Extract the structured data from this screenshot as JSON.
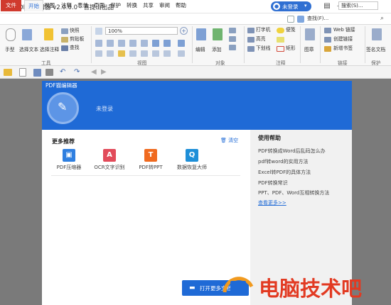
{
  "titlebar": {
    "title": "PDF猫编辑器 v2.0.0.0 - 喜提山出品",
    "user_label": "未登录",
    "user_arrow": "▾",
    "minimize": "—",
    "restore": "❐",
    "close": "✕",
    "extra": "▤"
  },
  "menu": {
    "tabs": [
      "文件",
      "开始",
      "视图",
      "注释",
      "表单",
      "页面",
      "保护",
      "转换",
      "共享",
      "审阅",
      "帮助"
    ],
    "search_placeholder": "搜索(S)...",
    "find": "查找(F)..."
  },
  "ribbon": {
    "tools": {
      "hand": "手型",
      "select_text": "选择文本",
      "select_annot": "选择注释",
      "snapshot": "快照",
      "clipboard": "剪贴板",
      "find": "查找",
      "group": "工具"
    },
    "view": {
      "zoom": "100%",
      "group": "视图"
    },
    "object": {
      "edit": "编辑",
      "add": "添加",
      "group": "对象"
    },
    "comment": {
      "typewriter": "打字机",
      "note": "便笺",
      "highlight": "高亮",
      "strikethrough": "下划线",
      "rect": "矩形",
      "group": "注释"
    },
    "image": {
      "label": "图章"
    },
    "links": {
      "web": "Web 链接",
      "create": "创建链接",
      "new_bookmark": "新增书签",
      "group": "链接"
    },
    "protect": {
      "sign": "签名文档",
      "group": "保护"
    }
  },
  "panel": {
    "title": "PDF猫编辑器",
    "login": "未登录",
    "more_title": "更多推荐",
    "clear": "清空",
    "help_title": "使用帮助",
    "more_help": "查看更多>>",
    "open_more": "打开更多文档"
  },
  "recommend": [
    {
      "label": "PDF压缩器",
      "icon": "compress-icon",
      "color": "#2f7fe0",
      "glyph": "▣"
    },
    {
      "label": "OCR文字识别",
      "icon": "ocr-icon",
      "color": "#e24b5a",
      "glyph": "A"
    },
    {
      "label": "PDF转PPT",
      "icon": "ppt-icon",
      "color": "#f06a1f",
      "glyph": "T"
    },
    {
      "label": "数据恢复大师",
      "icon": "recover-icon",
      "color": "#1e8fd8",
      "glyph": "Q"
    }
  ],
  "help_links": [
    "PDF转换成Word后乱码怎么办",
    "pdf转word的实用方法",
    "Excel转PDF的具体方法",
    "PDF转换常识",
    "PPT、PDF、Word互相转换方法"
  ],
  "watermark": {
    "text": "电脑技术吧"
  }
}
